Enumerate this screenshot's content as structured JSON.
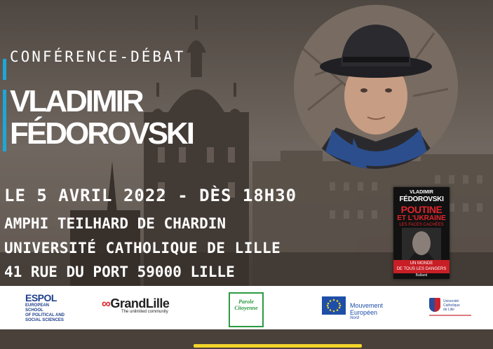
{
  "poster": {
    "kicker": "CONFÉRENCE-DÉBAT",
    "speaker_first": "VLADIMIR",
    "speaker_last": "FÉDOROVSKI",
    "date_line": "LE 5 AVRIL 2022 - DÈS 18H30",
    "venue_line": "AMPHI TEILHARD DE CHARDIN",
    "institution_line": "UNIVERSITÉ CATHOLIQUE DE LILLE",
    "address_line": "41 RUE DU PORT 59000 LILLE",
    "accent_color": "#1ea7d6",
    "highlight_color": "#f2d42b"
  },
  "book": {
    "author_first": "VLADIMIR",
    "author_last": "FÉDOROVSKI",
    "title_line1": "POUTINE",
    "title_line2": "ET L'UKRAINE",
    "subtitle": "LES FACES CACHÉES",
    "band_line1": "UN MONDE",
    "band_line2": "DE TOUS LES DANGERS",
    "publisher": "Balland",
    "accent_color": "#e0262d"
  },
  "logos": {
    "espol_mark": "ESPOL",
    "espol_line1": "EUROPEAN SCHOOL",
    "espol_line2": "OF POLITICAL AND",
    "espol_line3": "SOCIAL SCIENCES",
    "grandlille_mark": "GrandLille",
    "grandlille_tag": "The unlimited community",
    "parole_mark_1": "Parole",
    "parole_mark_2": "Citoyenne",
    "europe_line1": "Mouvement",
    "europe_line2": "Européen",
    "europe_line3": "Nord",
    "ucl_line1": "Université",
    "ucl_line2": "Catholique",
    "ucl_line3": "de Lille"
  }
}
